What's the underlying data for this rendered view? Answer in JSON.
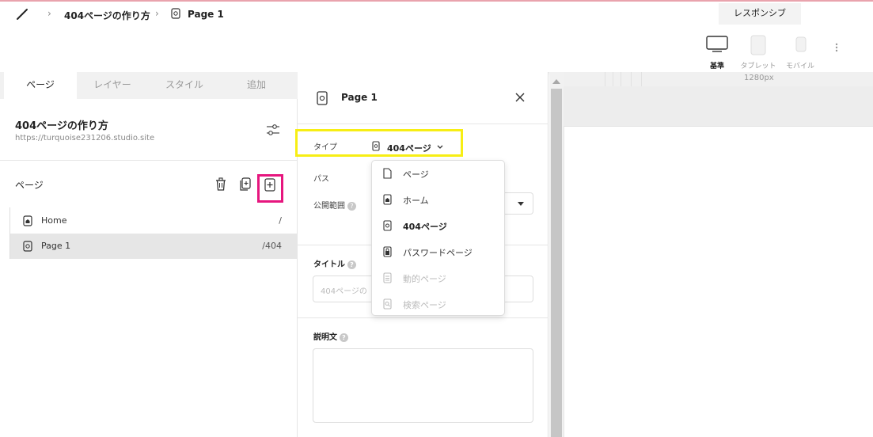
{
  "breadcrumb": {
    "project": "404ページの作り方",
    "page": "Page 1"
  },
  "responsive_tab": "レスポンシブ",
  "devices": [
    {
      "label": "基準",
      "active": true
    },
    {
      "label": "タブレット",
      "active": false
    },
    {
      "label": "モバイル",
      "active": false
    }
  ],
  "left_tabs": [
    "ページ",
    "レイヤー",
    "スタイル",
    "追加"
  ],
  "site": {
    "name": "404ページの作り方",
    "url": "https://turquoise231206.studio.site"
  },
  "pages_section": {
    "title": "ページ"
  },
  "pages": [
    {
      "name": "Home",
      "path": "/",
      "selected": false
    },
    {
      "name": "Page 1",
      "path": "/404",
      "selected": true
    }
  ],
  "panel": {
    "title": "Page 1",
    "type_label": "タイプ",
    "type_value": "404ページ",
    "path_label": "パス",
    "visibility_label": "公開範囲",
    "title_label": "タイトル",
    "title_placeholder": "404ページの",
    "description_label": "説明文"
  },
  "type_menu": [
    {
      "label": "ページ",
      "icon": "page-icon",
      "disabled": false,
      "selected": false
    },
    {
      "label": "ホーム",
      "icon": "home-page-icon",
      "disabled": false,
      "selected": false
    },
    {
      "label": "404ページ",
      "icon": "404-page-icon",
      "disabled": false,
      "selected": true
    },
    {
      "label": "パスワードページ",
      "icon": "password-page-icon",
      "disabled": false,
      "selected": false
    },
    {
      "label": "動的ページ",
      "icon": "dynamic-page-icon",
      "disabled": true,
      "selected": false
    },
    {
      "label": "検索ページ",
      "icon": "search-page-icon",
      "disabled": true,
      "selected": false
    }
  ],
  "canvas": {
    "width_label": "1280px"
  },
  "highlight_colors": {
    "yellow": "#f7ee14",
    "pink": "#e6167e"
  }
}
